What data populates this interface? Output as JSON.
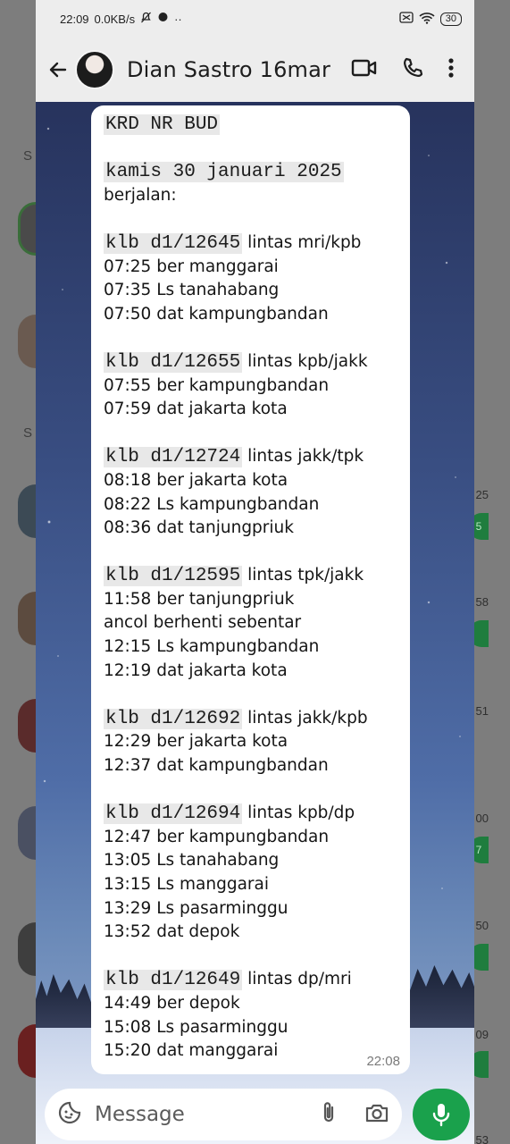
{
  "status_bar": {
    "time": "22:09",
    "network_speed": "0.0KB/s",
    "dots": "··",
    "battery": "30"
  },
  "header": {
    "contact_name": "Dian Sastro 16mar"
  },
  "background_app": {
    "section_letters": [
      "S",
      "S"
    ],
    "times": [
      "25",
      "58",
      "51",
      "00",
      "50",
      "09",
      "53"
    ],
    "badges": [
      "5",
      "",
      "",
      "7",
      "",
      "",
      ""
    ]
  },
  "message": {
    "time": "22:08",
    "lines": [
      {
        "mono": "KRD NR BUD",
        "text": ""
      },
      {
        "mono": "",
        "text": ""
      },
      {
        "mono": "kamis 30 januari 2025",
        "text": ""
      },
      {
        "mono": "",
        "text": "berjalan:"
      },
      {
        "mono": "",
        "text": ""
      },
      {
        "mono": "klb d1/12645",
        "text": " lintas mri/kpb"
      },
      {
        "mono": "",
        "text": "07:25 ber manggarai"
      },
      {
        "mono": "",
        "text": "07:35 Ls tanahabang"
      },
      {
        "mono": "",
        "text": "07:50 dat kampungbandan"
      },
      {
        "mono": "",
        "text": ""
      },
      {
        "mono": "klb d1/12655",
        "text": " lintas kpb/jakk"
      },
      {
        "mono": "",
        "text": "07:55 ber kampungbandan"
      },
      {
        "mono": "",
        "text": "07:59 dat jakarta kota"
      },
      {
        "mono": "",
        "text": ""
      },
      {
        "mono": "klb d1/12724",
        "text": " lintas jakk/tpk"
      },
      {
        "mono": "",
        "text": "08:18 ber jakarta kota"
      },
      {
        "mono": "",
        "text": "08:22 Ls kampungbandan"
      },
      {
        "mono": "",
        "text": "08:36 dat tanjungpriuk"
      },
      {
        "mono": "",
        "text": ""
      },
      {
        "mono": "klb d1/12595",
        "text": " lintas tpk/jakk"
      },
      {
        "mono": "",
        "text": "11:58 ber tanjungpriuk"
      },
      {
        "mono": "",
        "text": "ancol berhenti sebentar"
      },
      {
        "mono": "",
        "text": "12:15 Ls kampungbandan"
      },
      {
        "mono": "",
        "text": "12:19 dat jakarta kota"
      },
      {
        "mono": "",
        "text": ""
      },
      {
        "mono": "klb d1/12692",
        "text": " lintas jakk/kpb"
      },
      {
        "mono": "",
        "text": "12:29 ber jakarta kota"
      },
      {
        "mono": "",
        "text": "12:37 dat kampungbandan"
      },
      {
        "mono": "",
        "text": ""
      },
      {
        "mono": "klb d1/12694",
        "text": " lintas kpb/dp"
      },
      {
        "mono": "",
        "text": "12:47 ber kampungbandan"
      },
      {
        "mono": "",
        "text": "13:05 Ls tanahabang"
      },
      {
        "mono": "",
        "text": "13:15 Ls manggarai"
      },
      {
        "mono": "",
        "text": "13:29 Ls pasarminggu"
      },
      {
        "mono": "",
        "text": "13:52 dat depok"
      },
      {
        "mono": "",
        "text": ""
      },
      {
        "mono": "klb d1/12649",
        "text": " lintas dp/mri"
      },
      {
        "mono": "",
        "text": "14:49 ber depok"
      },
      {
        "mono": "",
        "text": "15:08 Ls pasarminggu"
      },
      {
        "mono": "",
        "text": "15:20 dat manggarai"
      }
    ]
  },
  "composer": {
    "placeholder": "Message"
  },
  "icons": {
    "back": "arrow-left-icon",
    "video": "video-call-icon",
    "phone": "voice-call-icon",
    "menu": "more-vert-icon",
    "emoji": "sticker-icon",
    "attach": "paperclip-icon",
    "camera": "camera-icon",
    "mic": "microphone-icon"
  },
  "colors": {
    "accent_green": "#1aa14c",
    "header_bg": "#ededed",
    "bubble_bg": "#ffffff",
    "mono_highlight": "#e8e8e8"
  }
}
